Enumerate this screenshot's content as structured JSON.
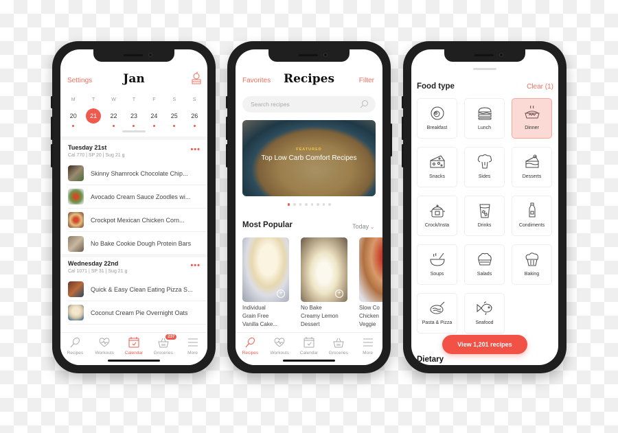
{
  "colors": {
    "accent": "#ee5a4e",
    "accent_light": "#fbd9d5",
    "text": "#222222",
    "muted": "#999999"
  },
  "calendar_screen": {
    "left_link": "Settings",
    "title": "Jan",
    "right_icon": "apple-books-icon",
    "weekdays": [
      "M",
      "T",
      "W",
      "T",
      "F",
      "S",
      "S"
    ],
    "dates": [
      {
        "num": "20",
        "selected": false
      },
      {
        "num": "21",
        "selected": true
      },
      {
        "num": "22",
        "selected": false
      },
      {
        "num": "23",
        "selected": false
      },
      {
        "num": "24",
        "selected": false
      },
      {
        "num": "25",
        "selected": false
      },
      {
        "num": "26",
        "selected": false
      }
    ],
    "days": [
      {
        "title": "Tuesday 21st",
        "meta": "Cal 770  | SP 20   | Sug 21 g",
        "more": "•••",
        "recipes": [
          "Skinny Shamrock Chocolate Chip...",
          "Avocado Cream Sauce Zoodles wi...",
          "Crockpot Mexican Chicken Corn...",
          "No Bake Cookie Dough Protein Bars"
        ]
      },
      {
        "title": "Wednesday 22nd",
        "meta": "Cal 1071  | SP 31   | Sug 21 g",
        "more": "•••",
        "recipes": [
          "Quick & Easy Clean Eating Pizza S...",
          "Coconut Cream Pie Overnight Oats"
        ]
      }
    ],
    "tabs": [
      {
        "label": "Recipes",
        "icon": "whisk-icon",
        "active": false
      },
      {
        "label": "Workouts",
        "icon": "heart-pulse-icon",
        "active": false
      },
      {
        "label": "Calendar",
        "icon": "calendar-icon",
        "active": true
      },
      {
        "label": "Groceries",
        "icon": "basket-icon",
        "active": false,
        "badge": "237"
      },
      {
        "label": "More",
        "icon": "menu-icon",
        "active": false
      }
    ]
  },
  "recipes_screen": {
    "left_link": "Favorites",
    "title": "Recipes",
    "right_link": "Filter",
    "search_placeholder": "Search recipes",
    "featured": {
      "tag": "FEATURED",
      "title": "Top Low Carb Comfort Recipes"
    },
    "carousel": {
      "count": 8,
      "active_index": 0
    },
    "section_title": "Most Popular",
    "period_select": "Today",
    "cards": [
      {
        "caption": "Individual\nGrain Free\nVanilla Cake..."
      },
      {
        "caption": "No Bake\nCreamy Lemon\nDessert"
      },
      {
        "caption": "Slow Co\nChicken\nVeggie"
      }
    ],
    "tabs": [
      {
        "label": "Recipes",
        "icon": "whisk-icon",
        "active": true
      },
      {
        "label": "Workouts",
        "icon": "heart-pulse-icon",
        "active": false
      },
      {
        "label": "Calendar",
        "icon": "calendar-icon",
        "active": false
      },
      {
        "label": "Groceries",
        "icon": "basket-icon",
        "active": false
      },
      {
        "label": "More",
        "icon": "menu-icon",
        "active": false
      }
    ]
  },
  "filter_screen": {
    "title": "Food type",
    "clear_link": "Clear (1)",
    "food_types": [
      {
        "label": "Breakfast",
        "icon": "fried-egg-icon",
        "selected": false
      },
      {
        "label": "Lunch",
        "icon": "sandwich-icon",
        "selected": false
      },
      {
        "label": "Dinner",
        "icon": "pie-icon",
        "selected": true
      },
      {
        "label": "Snacks",
        "icon": "cheese-icon",
        "selected": false
      },
      {
        "label": "Sides",
        "icon": "broccoli-icon",
        "selected": false
      },
      {
        "label": "Desserts",
        "icon": "cake-slice-icon",
        "selected": false
      },
      {
        "label": "Crock/Insta",
        "icon": "pot-icon",
        "selected": false
      },
      {
        "label": "Drinks",
        "icon": "glass-icon",
        "selected": false
      },
      {
        "label": "Condiments",
        "icon": "bottle-icon",
        "selected": false
      },
      {
        "label": "Soups",
        "icon": "soup-bowl-icon",
        "selected": false
      },
      {
        "label": "Salads",
        "icon": "salad-icon",
        "selected": false
      },
      {
        "label": "Baking",
        "icon": "muffin-icon",
        "selected": false
      },
      {
        "label": "Pasta & Pizza",
        "icon": "pasta-icon",
        "selected": false
      },
      {
        "label": "Seafood",
        "icon": "fish-icon",
        "selected": false
      }
    ],
    "cta_label": "View 1,201 recipes",
    "next_section": "Dietary"
  }
}
